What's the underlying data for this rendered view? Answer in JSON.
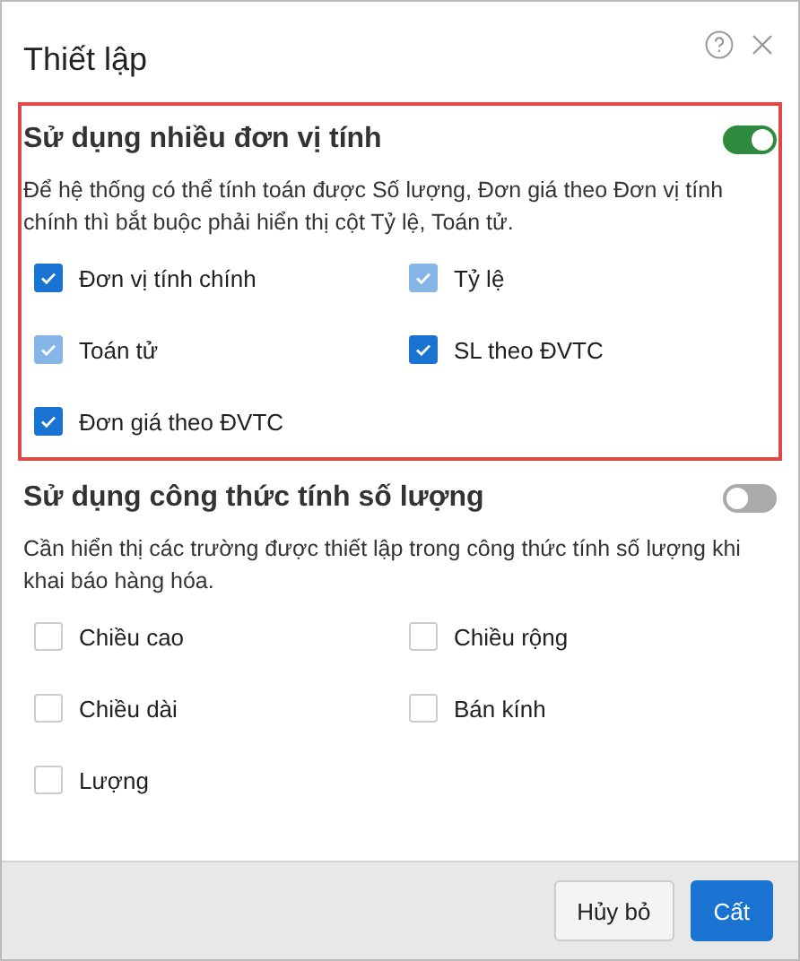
{
  "dialog": {
    "title": "Thiết lập"
  },
  "sections": [
    {
      "heading": "Sử dụng nhiều đơn vị tính",
      "on": true,
      "highlighted": true,
      "description": "Để hệ thống có thể tính toán được Số lượng, Đơn giá theo Đơn vị tính chính thì bắt buộc phải hiển thị cột Tỷ lệ, Toán tử.",
      "options": [
        {
          "label": "Đơn vị tính chính",
          "checked": true,
          "disabled": false
        },
        {
          "label": "Tỷ lệ",
          "checked": true,
          "disabled": true
        },
        {
          "label": "Toán tử",
          "checked": true,
          "disabled": true
        },
        {
          "label": "SL theo ĐVTC",
          "checked": true,
          "disabled": false
        },
        {
          "label": "Đơn giá theo ĐVTC",
          "checked": true,
          "disabled": false
        }
      ]
    },
    {
      "heading": "Sử dụng công thức tính số lượng",
      "on": false,
      "highlighted": false,
      "description": "Cần hiển thị các trường được thiết lập trong công thức tính số lượng khi khai báo hàng hóa.",
      "options": [
        {
          "label": "Chiều cao",
          "checked": false,
          "disabled": false
        },
        {
          "label": "Chiều rộng",
          "checked": false,
          "disabled": false
        },
        {
          "label": "Chiều dài",
          "checked": false,
          "disabled": false
        },
        {
          "label": "Bán kính",
          "checked": false,
          "disabled": false
        },
        {
          "label": "Lượng",
          "checked": false,
          "disabled": false
        }
      ]
    }
  ],
  "buttons": [
    {
      "label": "Hủy bỏ",
      "kind": "secondary"
    },
    {
      "label": "Cất",
      "kind": "primary"
    }
  ]
}
